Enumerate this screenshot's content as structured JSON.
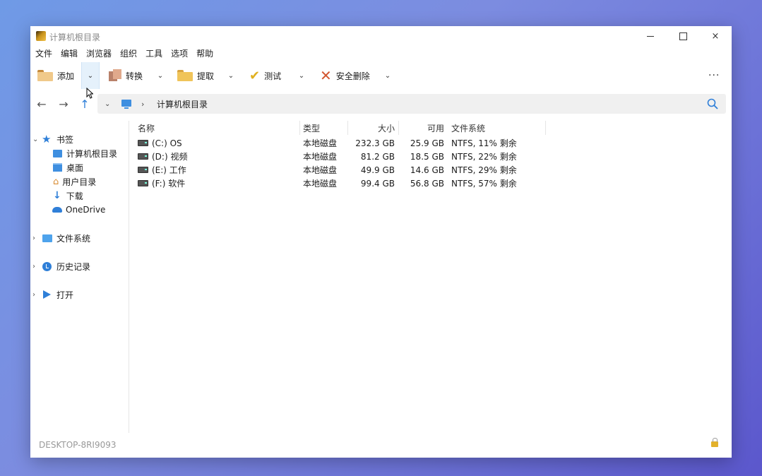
{
  "window": {
    "title": "计算机根目录",
    "controls": {
      "minimize": "minimize-icon",
      "maximize": "maximize-icon",
      "close": "×"
    }
  },
  "menu": [
    "文件",
    "编辑",
    "浏览器",
    "组织",
    "工具",
    "选项",
    "帮助"
  ],
  "toolbar": {
    "add_label": "添加",
    "convert_label": "转换",
    "extract_label": "提取",
    "test_label": "测试",
    "delete_label": "安全删除",
    "more_label": "···",
    "dropdown_glyph": "⌄"
  },
  "nav": {
    "back": "←",
    "forward": "→",
    "up": "↑",
    "address_chevron": "⌄",
    "separator": "›",
    "path": "计算机根目录"
  },
  "sidebar": {
    "bookmarks": {
      "label": "书签",
      "chevron": "⌄",
      "children": [
        "计算机根目录",
        "桌面",
        "用户目录",
        "下载",
        "OneDrive"
      ]
    },
    "filesystem": {
      "label": "文件系统",
      "chevron": "›"
    },
    "history": {
      "label": "历史记录",
      "chevron": "›"
    },
    "open": {
      "label": "打开",
      "chevron": "›"
    }
  },
  "filelist": {
    "columns": {
      "name": "名称",
      "type": "类型",
      "size": "大小",
      "free": "可用",
      "fs": "文件系统"
    },
    "rows": [
      {
        "name": "(C:) OS",
        "type": "本地磁盘",
        "size": "232.3 GB",
        "free": "25.9 GB",
        "fs": "NTFS, 11% 剩余"
      },
      {
        "name": "(D:) 视频",
        "type": "本地磁盘",
        "size": "81.2 GB",
        "free": "18.5 GB",
        "fs": "NTFS, 22% 剩余"
      },
      {
        "name": "(E:) 工作",
        "type": "本地磁盘",
        "size": "49.9 GB",
        "free": "14.6 GB",
        "fs": "NTFS, 29% 剩余"
      },
      {
        "name": "(F:) 软件",
        "type": "本地磁盘",
        "size": "99.4 GB",
        "free": "56.8 GB",
        "fs": "NTFS, 57% 剩余"
      }
    ]
  },
  "status": {
    "computer_name": "DESKTOP-8RI9093"
  },
  "colors": {
    "accent": "#2f7fd8",
    "background_start": "#6f9ae6",
    "background_end": "#5b57cc"
  }
}
